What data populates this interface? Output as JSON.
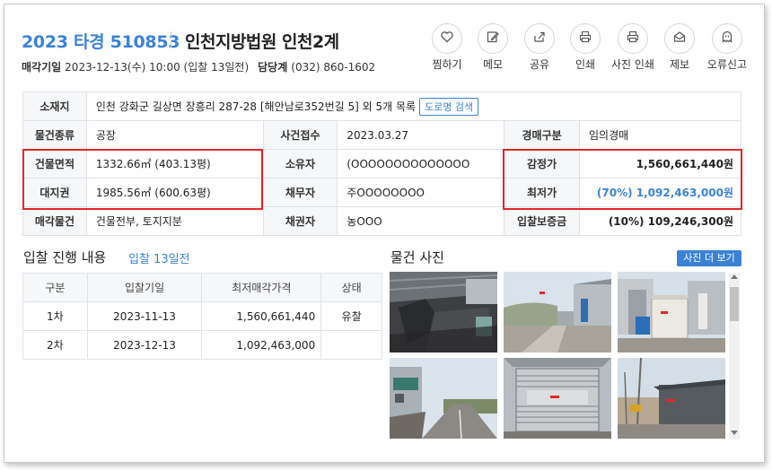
{
  "header": {
    "case_number": "2023 타경 510853",
    "court": "인천지방법원 인천2계",
    "sale_date_label": "매각기일",
    "sale_date": "2023-12-13(수) 10:00 (입찰 13일전)",
    "dept_label": "담당계",
    "dept_phone": "(032) 860-1602"
  },
  "actions": [
    {
      "label": "찜하기",
      "icon": "heart-icon"
    },
    {
      "label": "메모",
      "icon": "memo-icon"
    },
    {
      "label": "공유",
      "icon": "share-icon"
    },
    {
      "label": "인쇄",
      "icon": "print-icon"
    },
    {
      "label": "사진 인쇄",
      "icon": "print-icon"
    },
    {
      "label": "제보",
      "icon": "mail-icon"
    },
    {
      "label": "오류신고",
      "icon": "ghost-icon"
    }
  ],
  "info": {
    "address_label": "소재지",
    "address": "인천 강화군 길상면 장흥리 287-28 [해안남로352번길 5] 외 5개 목록",
    "road_search": "도로명 검색",
    "type_label": "물건종류",
    "type": "공장",
    "received_label": "사건접수",
    "received": "2023.03.27",
    "auction_kind_label": "경매구분",
    "auction_kind": "임의경매",
    "building_area_label": "건물면적",
    "building_area": "1332.66㎡ (403.13평)",
    "owner_label": "소유자",
    "owner": "(OOOOOOOOOOOOOO",
    "appraisal_label": "감정가",
    "appraisal": "1,560,661,440원",
    "land_right_label": "대지권",
    "land_right": "1985.56㎡ (600.63평)",
    "debtor_label": "채무자",
    "debtor": "주OOOOOOOO",
    "min_price_label": "최저가",
    "min_price": "(70%) 1,092,463,000원",
    "sale_object_label": "매각물건",
    "sale_object": "건물전부, 토지지분",
    "creditor_label": "채권자",
    "creditor": "농OOO",
    "deposit_label": "입찰보증금",
    "deposit": "(10%) 109,246,300원"
  },
  "bidding": {
    "title": "입찰 진행 내용",
    "subtitle": "입찰 13일전",
    "columns": [
      "구분",
      "입찰기일",
      "최저매각가격",
      "상태"
    ],
    "rows": [
      [
        "1차",
        "2023-11-13",
        "1,560,661,440",
        "유찰"
      ],
      [
        "2차",
        "2023-12-13",
        "1,092,463,000",
        ""
      ]
    ]
  },
  "photos": {
    "title": "물건 사진",
    "more_button": "사진 더 보기",
    "items": [
      "photo-1",
      "photo-2",
      "photo-3",
      "photo-4",
      "photo-5",
      "photo-6"
    ]
  },
  "colors": {
    "accent": "#3b82d6",
    "highlight_border": "#e0272a"
  }
}
